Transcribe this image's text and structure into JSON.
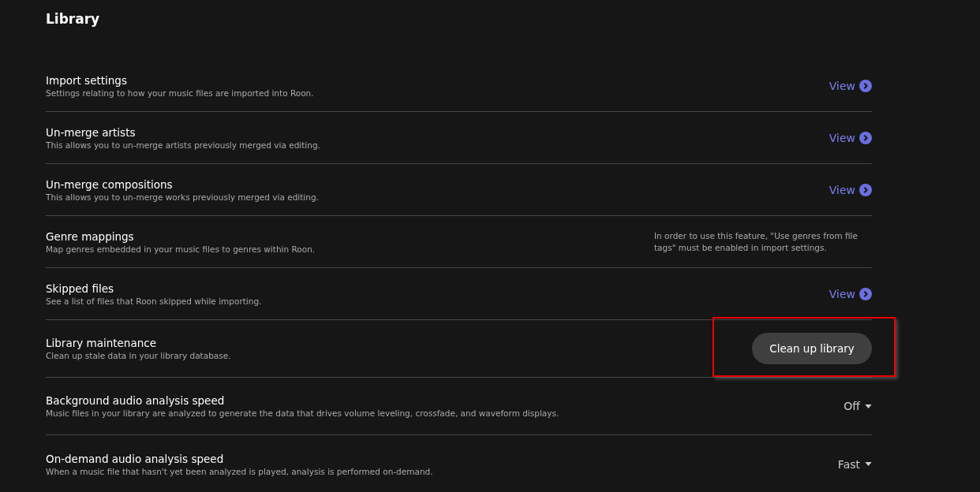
{
  "title": "Library",
  "rows": [
    {
      "kind": "link",
      "name": "Import settings",
      "description": "Settings relating to how your music files are imported into Roon.",
      "action": "View",
      "highlighted": false
    },
    {
      "kind": "link",
      "name": "Un-merge artists",
      "description": "This allows you to un-merge artists previously merged via editing.",
      "action": "View",
      "highlighted": false
    },
    {
      "kind": "link",
      "name": "Un-merge compositions",
      "description": "This allows you to un-merge works previously merged via editing.",
      "action": "View",
      "highlighted": false
    },
    {
      "kind": "note",
      "name": "Genre mappings",
      "description": "Map genres embedded in your music files to genres within Roon.",
      "action": "In order to use this feature, \"Use genres from file tags\" must be enabled in import settings.",
      "highlighted": false
    },
    {
      "kind": "link",
      "name": "Skipped files",
      "description": "See a list of files that Roon skipped while importing.",
      "action": "View",
      "highlighted": false
    },
    {
      "kind": "button",
      "name": "Library maintenance",
      "description": "Clean up stale data in your library database.",
      "action": "Clean up library",
      "highlighted": true
    },
    {
      "kind": "dropdown",
      "name": "Background audio analysis speed",
      "description": "Music files in your library are analyzed to generate the data that drives volume leveling, crossfade, and waveform displays.",
      "action": "Off",
      "highlighted": false
    },
    {
      "kind": "dropdown",
      "name": "On-demand audio analysis speed",
      "description": "When a music file that hasn't yet been analyzed is played, analysis is performed on-demand.",
      "action": "Fast",
      "highlighted": false
    }
  ]
}
